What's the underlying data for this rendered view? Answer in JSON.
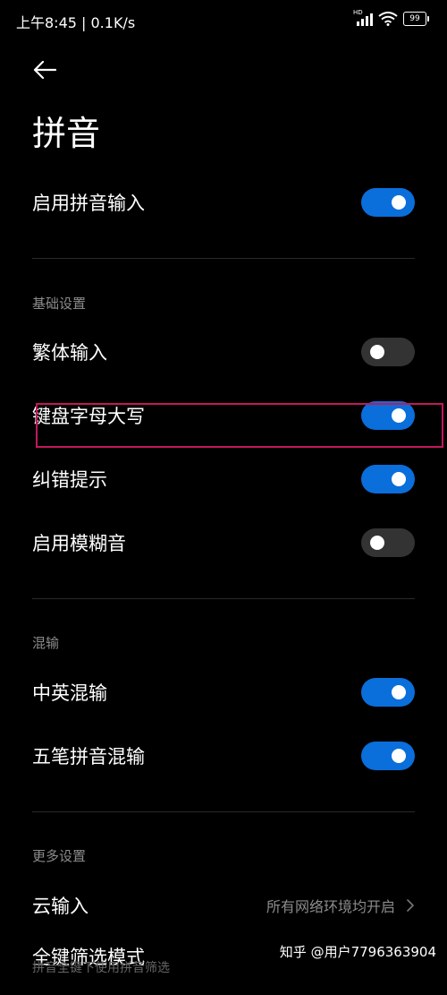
{
  "status_bar": {
    "time_speed": "上午8:45 | 0.1K/s",
    "network_label": "HD",
    "battery": "99"
  },
  "page": {
    "title": "拼音"
  },
  "main_toggle": {
    "label": "启用拼音输入",
    "on": true
  },
  "sections": {
    "basic": {
      "header": "基础设置",
      "items": [
        {
          "label": "繁体输入",
          "on": false
        },
        {
          "label": "键盘字母大写",
          "on": true
        },
        {
          "label": "纠错提示",
          "on": true
        },
        {
          "label": "启用模糊音",
          "on": false
        }
      ]
    },
    "mixed": {
      "header": "混输",
      "items": [
        {
          "label": "中英混输",
          "on": true
        },
        {
          "label": "五笔拼音混输",
          "on": true
        }
      ]
    },
    "more": {
      "header": "更多设置",
      "cloud": {
        "label": "云输入",
        "value": "所有网络环境均开启"
      },
      "filter": {
        "label": "全键筛选模式",
        "subtitle": "拼音全键下使用拼音筛选"
      }
    }
  },
  "watermark": "知乎 @用户7796363904",
  "colors": {
    "accent": "#0a6edb",
    "toggle_off": "#333333",
    "highlight": "#c2185b"
  }
}
